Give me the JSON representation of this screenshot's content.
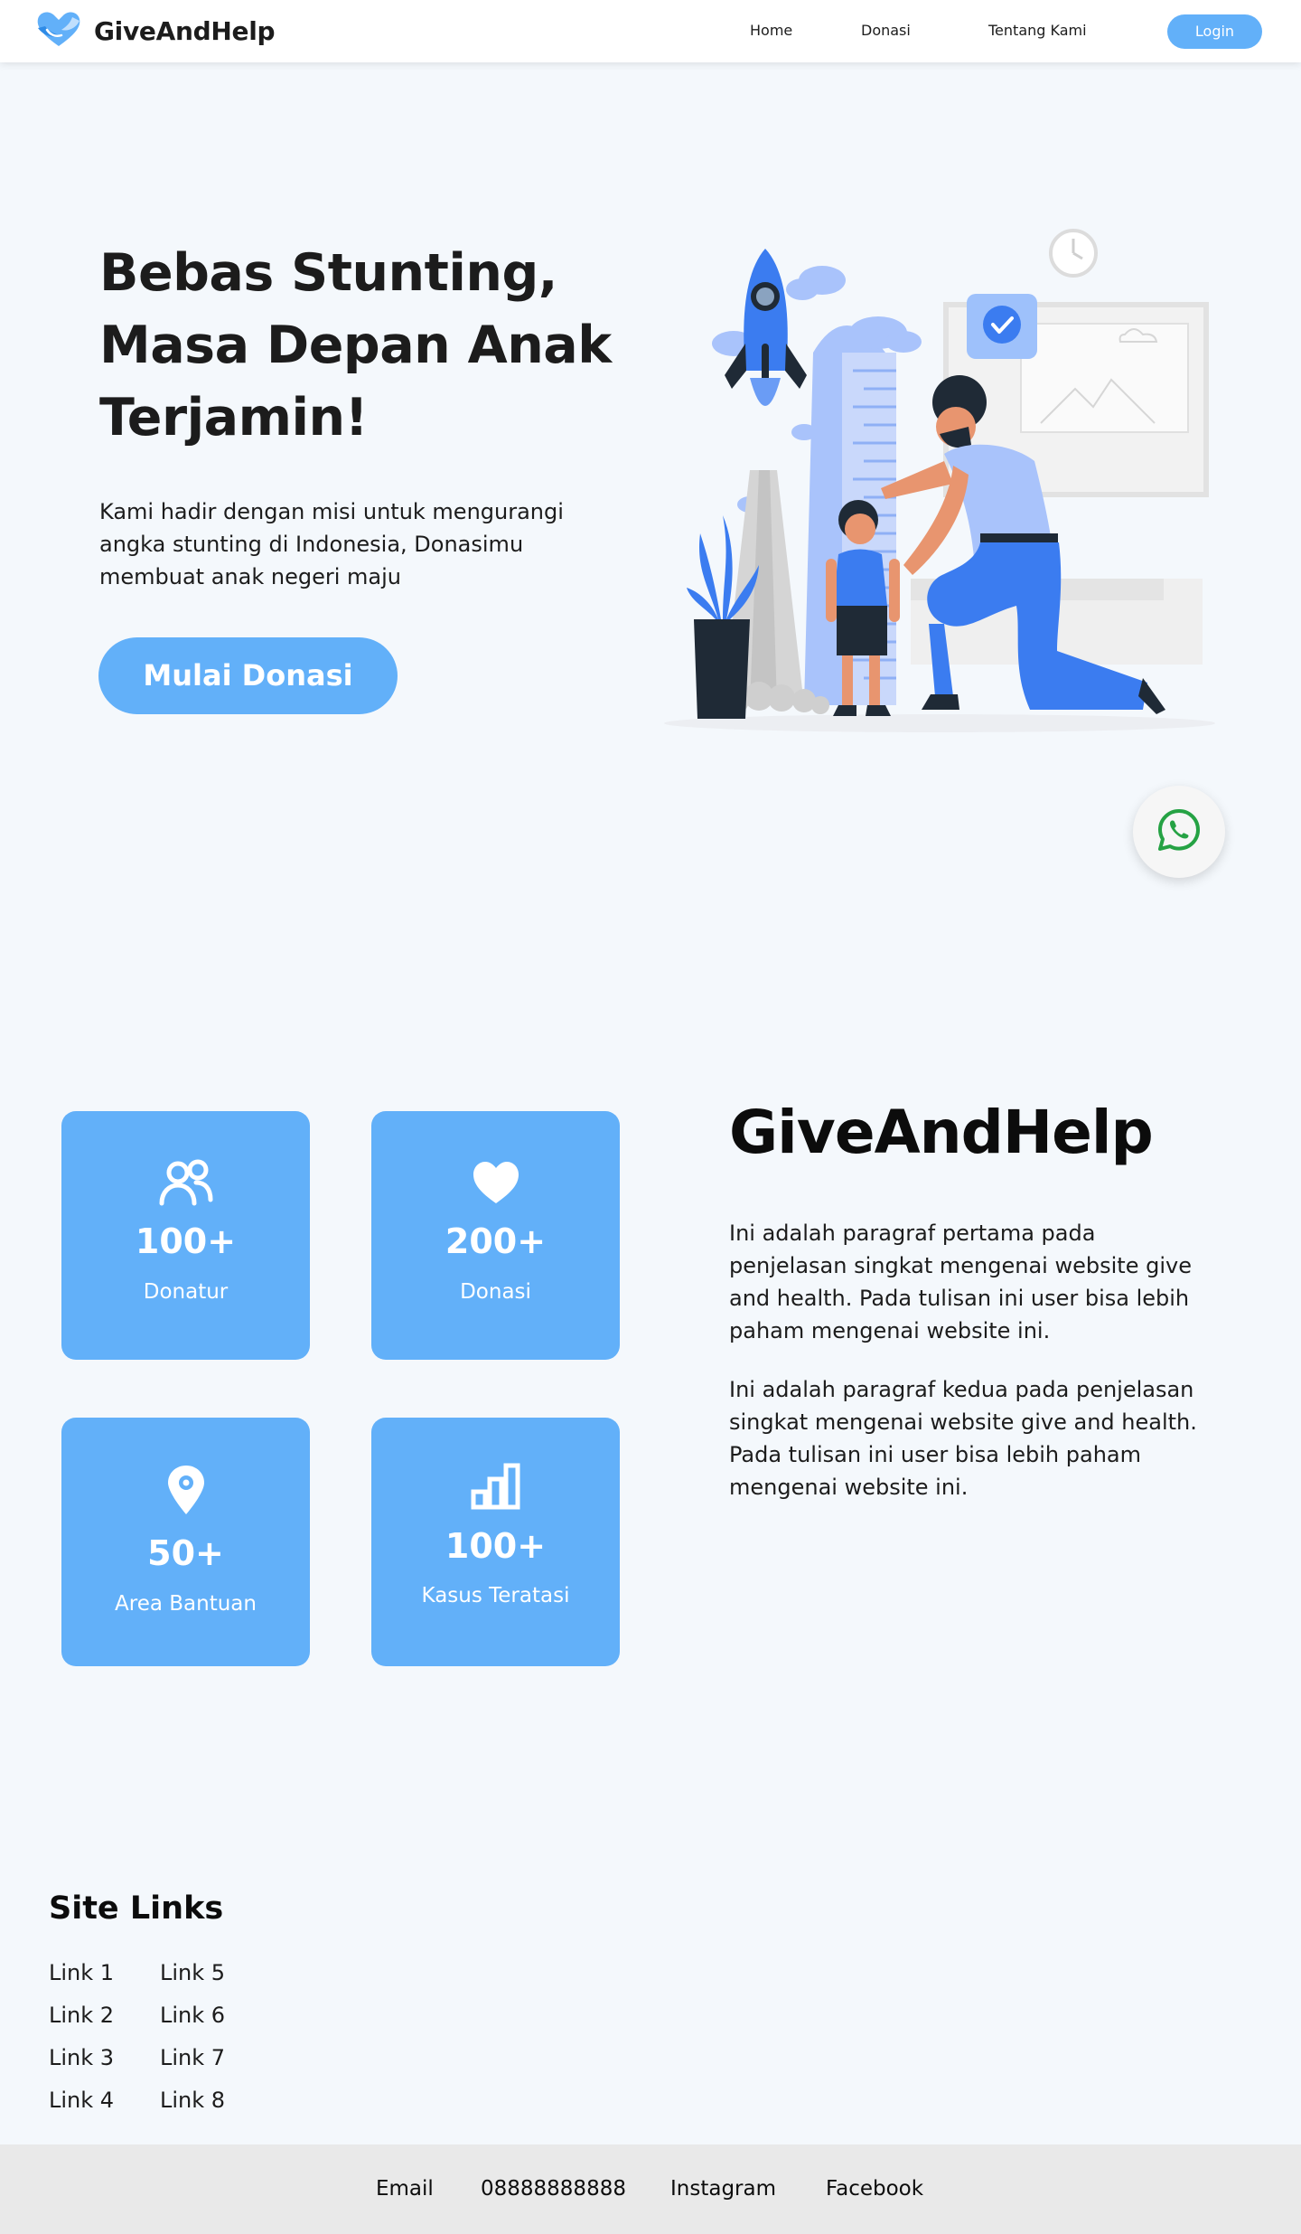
{
  "navbar": {
    "brand": "GiveAndHelp",
    "logo_icon": "heart-hands-icon",
    "links": [
      "Home",
      "Donasi",
      "Tentang Kami"
    ],
    "login_label": "Login"
  },
  "hero": {
    "title": "Bebas Stunting, Masa Depan Anak Terjamin!",
    "description": "Kami hadir dengan misi untuk mengurangi angka stunting di Indonesia, Donasimu membuat anak negeri maju",
    "cta_label": "Mulai Donasi",
    "illustration": "father-measuring-child-height-illustration"
  },
  "whatsapp": {
    "icon": "whatsapp-icon"
  },
  "stats": [
    {
      "icon": "users-icon",
      "value": "100+",
      "label": "Donatur"
    },
    {
      "icon": "heart-icon",
      "value": "200+",
      "label": "Donasi"
    },
    {
      "icon": "location-pin-icon",
      "value": "50+",
      "label": "Area Bantuan"
    },
    {
      "icon": "bar-chart-icon",
      "value": "100+",
      "label": "Kasus Teratasi"
    }
  ],
  "about": {
    "title": "GiveAndHelp",
    "paragraph1": "Ini adalah paragraf pertama pada penjelasan singkat mengenai website give and health. Pada tulisan ini user bisa lebih paham mengenai website ini.",
    "paragraph2": "Ini adalah paragraf kedua pada penjelasan singkat mengenai website give and health. Pada tulisan ini user bisa lebih paham mengenai website ini."
  },
  "site_links": {
    "title": "Site Links",
    "links": [
      "Link 1",
      "Link 2",
      "Link 3",
      "Link 4",
      "Link 5",
      "Link 6",
      "Link 7",
      "Link 8"
    ]
  },
  "footer": {
    "items": [
      "Email",
      "08888888888",
      "Instagram",
      "Facebook"
    ]
  },
  "colors": {
    "primary": "#62b0f9",
    "background": "#f4f8fc",
    "footer_bg": "#e9e9e9",
    "whatsapp_green": "#25a244"
  }
}
